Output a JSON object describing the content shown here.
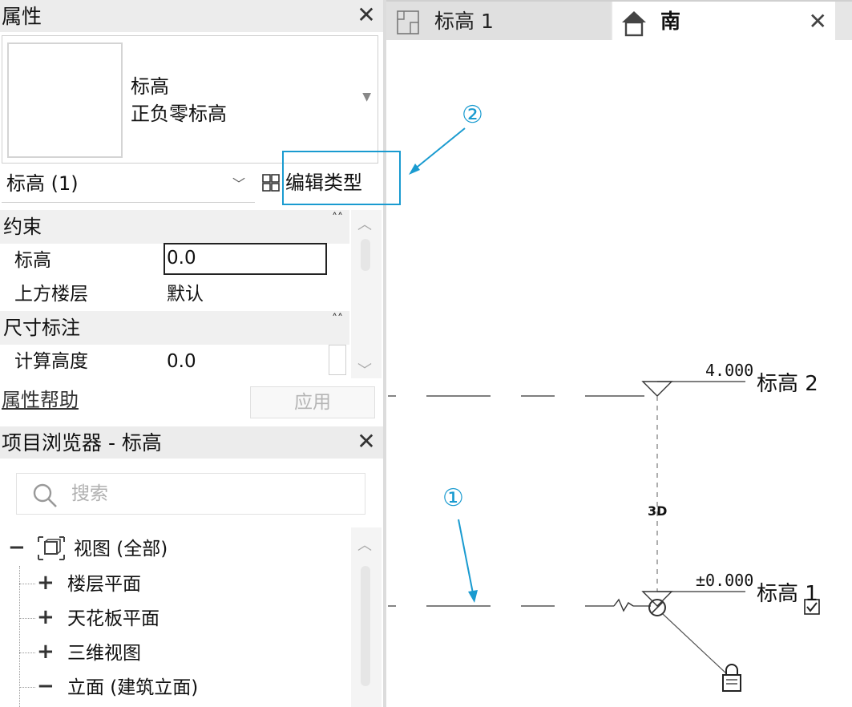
{
  "properties": {
    "title": "属性",
    "type_family": "标高",
    "type_name": "正负零标高",
    "selector_label": "标高 (1)",
    "edit_type_label": "编辑类型",
    "categories": [
      {
        "label": "约束",
        "rows": [
          {
            "name": "标高",
            "value": "0.0"
          },
          {
            "name": "上方楼层",
            "value": "默认"
          }
        ]
      },
      {
        "label": "尺寸标注",
        "rows": [
          {
            "name": "计算高度",
            "value": "0.0"
          }
        ]
      }
    ],
    "help_link": "属性帮助",
    "apply_label": "应用"
  },
  "project_browser": {
    "title": "项目浏览器 - 标高",
    "search_placeholder": "搜索",
    "tree": [
      {
        "toggle": "−",
        "label": "视图 (全部)"
      },
      {
        "toggle": "+",
        "label": "楼层平面"
      },
      {
        "toggle": "+",
        "label": "天花板平面"
      },
      {
        "toggle": "+",
        "label": "三维视图"
      },
      {
        "toggle": "−",
        "label": "立面 (建筑立面)"
      }
    ]
  },
  "view_tabs": [
    {
      "label": "标高 1",
      "icon": "floor-plan-icon",
      "active": false
    },
    {
      "label": "南",
      "icon": "elevation-view-icon",
      "active": true
    }
  ],
  "canvas": {
    "level_top": {
      "elevation": "4.000",
      "name": "标高 2"
    },
    "level_bottom": {
      "elevation": "±0.000",
      "name": "标高 1"
    },
    "badge_3d": "3D",
    "annotation_1": "①",
    "annotation_2": "②"
  },
  "colors": {
    "annotation": "#1a9bd0",
    "header_bg": "#ececec"
  }
}
